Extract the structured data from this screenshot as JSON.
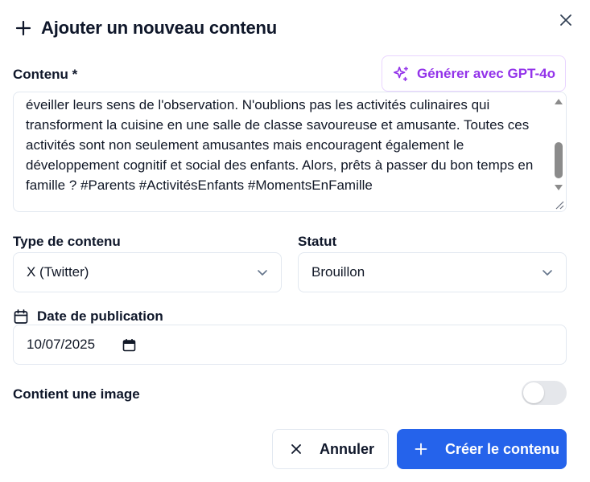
{
  "dialog": {
    "title": "Ajouter un nouveau contenu"
  },
  "content_field": {
    "label": "Contenu *",
    "generate_button_label": "Générer avec GPT-4o",
    "text": "cours à leur imagination, ou organisez des chasses au trésor dans votre jardin pour éveiller leurs sens de l'observation. N'oublions pas les activités culinaires qui transforment la cuisine en une salle de classe savoureuse et amusante. Toutes ces activités sont non seulement amusantes mais encouragent également le développement cognitif et social des enfants. Alors, prêts à passer du bon temps en famille ? #Parents #ActivitésEnfants #MomentsEnFamille"
  },
  "content_type": {
    "label": "Type de contenu",
    "value": "X (Twitter)"
  },
  "status": {
    "label": "Statut",
    "value": "Brouillon"
  },
  "publication_date": {
    "label": "Date de publication",
    "value": "10/07/2025"
  },
  "image_toggle": {
    "label": "Contient une image",
    "on": false
  },
  "actions": {
    "cancel_label": "Annuler",
    "create_label": "Créer le contenu"
  },
  "colors": {
    "accent": "#2563eb",
    "gpt": "#9333ea"
  }
}
